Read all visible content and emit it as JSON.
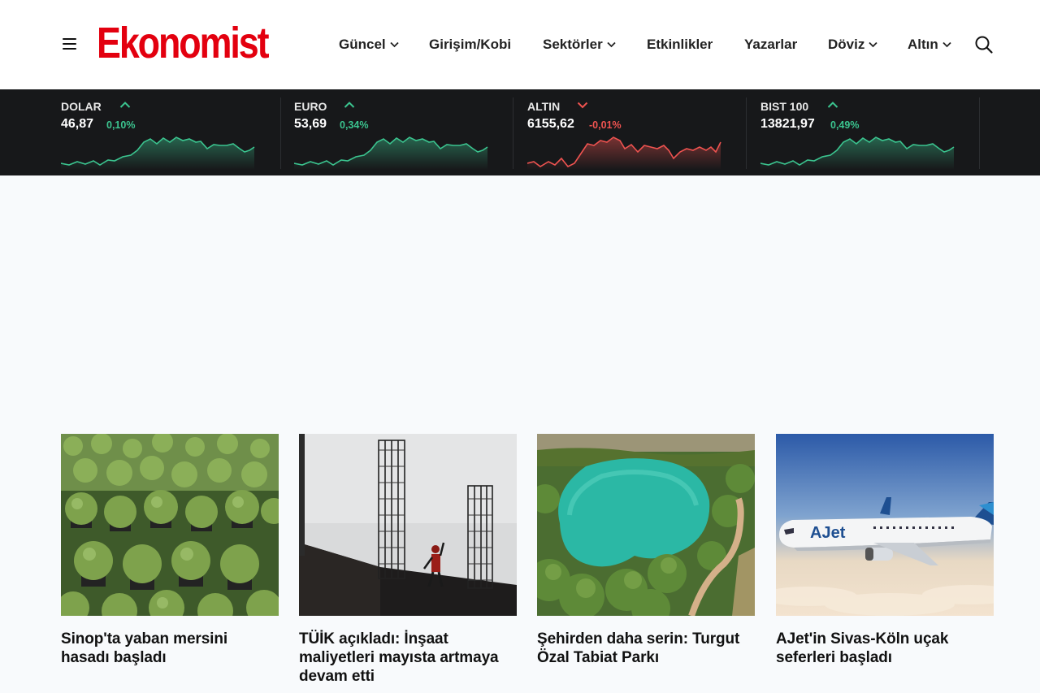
{
  "header": {
    "logo_text": "Ekonomist",
    "brand_color": "#e3000f",
    "menu_icon": "hamburger-menu-icon",
    "search_icon": "search-icon",
    "nav": [
      {
        "label": "Güncel",
        "has_dropdown": true
      },
      {
        "label": "Girişim/Kobi",
        "has_dropdown": false
      },
      {
        "label": "Sektörler",
        "has_dropdown": true
      },
      {
        "label": "Etkinlikler",
        "has_dropdown": false
      },
      {
        "label": "Yazarlar",
        "has_dropdown": false
      },
      {
        "label": "Döviz",
        "has_dropdown": true
      },
      {
        "label": "Altın",
        "has_dropdown": true
      }
    ]
  },
  "ticker": [
    {
      "name": "DOLAR",
      "value": "46,87",
      "change": "0,10%",
      "direction": "up",
      "color": "#3bc48f"
    },
    {
      "name": "EURO",
      "value": "53,69",
      "change": "0,34%",
      "direction": "up",
      "color": "#3bc48f"
    },
    {
      "name": "ALTIN",
      "value": "6155,62",
      "change": "-0,01%",
      "direction": "down",
      "color": "#ef5350"
    },
    {
      "name": "BIST 100",
      "value": "13821,97",
      "change": "0,49%",
      "direction": "up",
      "color": "#3bc48f"
    }
  ],
  "articles": [
    {
      "title": "Sinop'ta yaban mersini hasadı başladı",
      "image": "blueberry-field-photo"
    },
    {
      "title": "TÜİK açıkladı: İnşaat maliyetleri mayısta artmaya devam etti",
      "image": "construction-worker-photo"
    },
    {
      "title": "Şehirden daha serin: Turgut Özal Tabiat Parkı",
      "image": "turquoise-lake-photo"
    },
    {
      "title": "AJet'in Sivas-Köln uçak seferleri başladı",
      "image": "ajet-airplane-photo"
    }
  ]
}
